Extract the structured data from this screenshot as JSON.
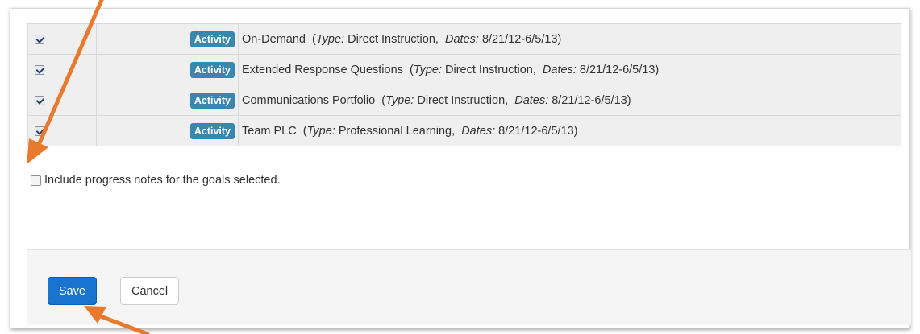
{
  "activities": [
    {
      "checked": true,
      "badge": "Activity",
      "title": "On-Demand",
      "type_label": "Type:",
      "type_value": "Direct Instruction,",
      "dates_label": "Dates:",
      "dates_value": "8/21/12-6/5/13)"
    },
    {
      "checked": true,
      "badge": "Activity",
      "title": "Extended Response Questions",
      "type_label": "Type:",
      "type_value": "Direct Instruction,",
      "dates_label": "Dates:",
      "dates_value": "8/21/12-6/5/13)"
    },
    {
      "checked": true,
      "badge": "Activity",
      "title": "Communications Portfolio",
      "type_label": "Type:",
      "type_value": "Direct Instruction,",
      "dates_label": "Dates:",
      "dates_value": "8/21/12-6/5/13)"
    },
    {
      "checked": true,
      "badge": "Activity",
      "title": "Team PLC",
      "type_label": "Type:",
      "type_value": "Professional Learning,",
      "dates_label": "Dates:",
      "dates_value": "8/21/12-6/5/13)"
    }
  ],
  "progress_notes": {
    "checked": false,
    "label": "Include progress notes for the goals selected."
  },
  "footer": {
    "save_label": "Save",
    "cancel_label": "Cancel"
  },
  "colors": {
    "badge": "#3a87ad",
    "save_button": "#1874cf",
    "annotation_arrow": "#e87a2e",
    "row_background": "#efefef"
  }
}
